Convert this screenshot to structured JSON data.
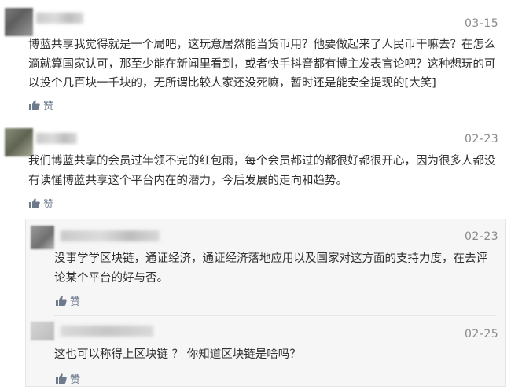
{
  "comments": [
    {
      "date": "03-15",
      "text": "博蓝共享我觉得就是一个局吧，这玩意居然能当货币用？他要做起来了人民币干嘛去？在怎么滴就算国家认可，那至少能在新闻里看到，或者快手抖音都有博主发表言论吧？这种想玩的可以投个几百块一千块的，无所谓比较人家还没死嘛，暂时还是能安全提现的[大笑]",
      "like_label": "赞"
    },
    {
      "date": "02-23",
      "text": "我们博蓝共享的会员过年领不完的红包雨，每个会员都过的都很好都很开心，因为很多人都没有读懂博蓝共享这个平台内在的潜力，今后发展的走向和趋势。",
      "like_label": "赞"
    }
  ],
  "replies": [
    {
      "date": "02-23",
      "text": "没事学学区块链，通证经济，通证经济落地应用以及国家对这方面的支持力度，在去评论某个平台的好与否。",
      "like_label": "赞"
    },
    {
      "date": "02-25",
      "text": "这也可以称得上区块链 ？ 你知道区块链是啥吗？",
      "like_label": "赞"
    }
  ]
}
